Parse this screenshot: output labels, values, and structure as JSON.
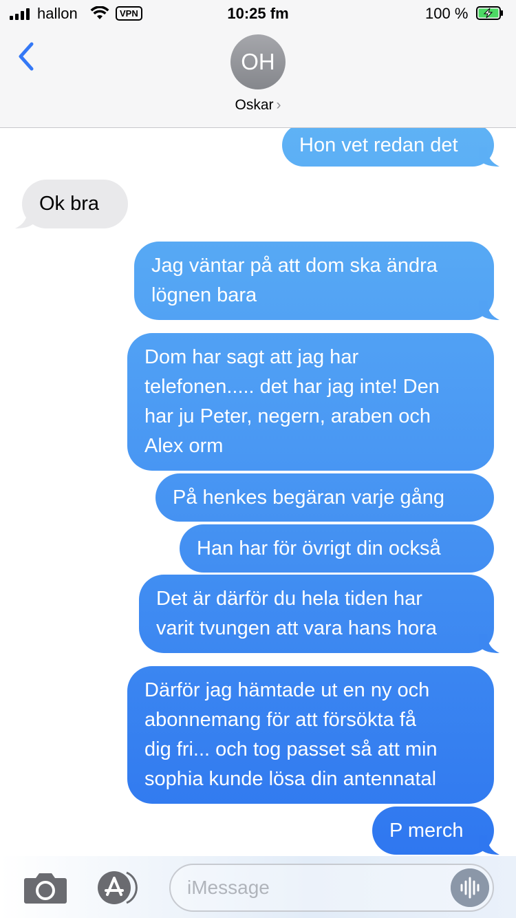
{
  "status_bar": {
    "carrier": "hallon",
    "vpn": "VPN",
    "time": "10:25 fm",
    "battery_percent": "100 %",
    "battery_level": 1.0,
    "battery_color": "#4cd964",
    "icons": [
      "cellular-signal-icon",
      "wifi-icon",
      "vpn-badge",
      "battery-charging-icon"
    ]
  },
  "header": {
    "back_icon": "chevron-left-icon",
    "avatar_initials": "OH",
    "contact_name": "Oskar",
    "contact_chevron": "›"
  },
  "messages": [
    {
      "direction": "sent",
      "text": "Hon vet redan det",
      "tail": true
    },
    {
      "direction": "received",
      "text": "Ok bra",
      "tail": true
    },
    {
      "direction": "sent",
      "lines": [
        "Jag väntar på att dom ska ändra",
        "lögnen bara"
      ],
      "tail": true
    },
    {
      "direction": "sent",
      "lines": [
        "Dom har sagt att jag har",
        "telefonen..... det har jag inte! Den",
        "har ju Peter, negern, araben och",
        "Alex orm"
      ],
      "tail": false
    },
    {
      "direction": "sent",
      "text": "På henkes begäran varje gång",
      "tail": false
    },
    {
      "direction": "sent",
      "text": "Han har för övrigt din också",
      "tail": false
    },
    {
      "direction": "sent",
      "lines": [
        "Det är därför du hela tiden har",
        "varit tvungen att vara hans hora"
      ],
      "tail": true
    },
    {
      "direction": "sent",
      "lines": [
        "Därför jag hämtade ut en ny och",
        "abonnemang för att försökta få",
        "dig fri... och tog passet så att min",
        "sophia kunde lösa din antennatal"
      ],
      "tail": false
    },
    {
      "direction": "sent",
      "text": "P merch",
      "tail": true
    }
  ],
  "input_bar": {
    "camera_icon": "camera-icon",
    "apps_icon": "app-store-icon",
    "placeholder": "iMessage",
    "audio_icon": "audio-waveform-icon"
  },
  "colors": {
    "sent_top": "#5fb2f5",
    "sent_bottom": "#2f77f0",
    "received": "#e9e9eb",
    "accent": "#3478f6"
  }
}
